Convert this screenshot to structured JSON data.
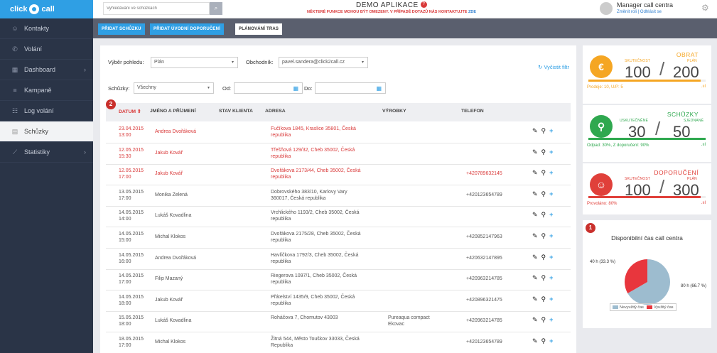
{
  "app": {
    "logo_text": "click",
    "logo_text2": "call"
  },
  "topbar": {
    "search_placeholder": "Vyhledávání ve schůzkách",
    "demo_title": "DEMO APLIKACE",
    "demo_badge": "?",
    "demo_subtitle": "NĚKTERÉ FUNKCE MOHOU BÝT OMEZENY. V PŘÍPADĚ DOTAZŮ NÁS KONTAKTUJTE",
    "demo_link": "ZDE",
    "user_name": "Manager call centra",
    "user_change_role": "Změnit roli",
    "user_separator": "|",
    "user_logout": "Odhlásit se"
  },
  "sidebar": {
    "items": [
      {
        "label": "Kontakty",
        "icon": "contacts-icon",
        "glyph": "☺",
        "chev": ""
      },
      {
        "label": "Volání",
        "icon": "phone-icon",
        "glyph": "✆",
        "chev": ""
      },
      {
        "label": "Dashboard",
        "icon": "dashboard-icon",
        "glyph": "▦",
        "chev": "›"
      },
      {
        "label": "Kampaně",
        "icon": "list-icon",
        "glyph": "≡",
        "chev": ""
      },
      {
        "label": "Log volání",
        "icon": "log-icon",
        "glyph": "☷",
        "chev": ""
      },
      {
        "label": "Schůzky",
        "icon": "calendar-icon",
        "glyph": "▤",
        "chev": ""
      },
      {
        "label": "Statistiky",
        "icon": "chart-icon",
        "glyph": "⟋",
        "chev": "›"
      }
    ]
  },
  "actions": {
    "add_meeting": "PŘIDAT SCHŮZKU",
    "add_referral": "PŘIDAT ÚVODNÍ DOPORUČENÍ",
    "plan_routes": "PLÁNOVÁNÍ TRAS"
  },
  "filters": {
    "view_label": "Výběr pohledu:",
    "view_value": "Plán",
    "dealer_label": "Obchodník:",
    "dealer_value": "pavel.sandera@click2call.cz",
    "meetings_label": "Schůzky:",
    "meetings_value": "Všechny",
    "from_label": "Od:",
    "to_label": "Do:",
    "clear": "Vyčistit filtr"
  },
  "table": {
    "badge": "2",
    "headers": [
      "DATUM ⇕",
      "JMÉNO A PŘÍJMENÍ",
      "STAV KLIENTA",
      "ADRESA",
      "VÝROBKY",
      "TELEFON"
    ],
    "rows": [
      {
        "date": "23.04.2015",
        "time": "13:00",
        "name": "Andrea Dvořáková",
        "addr1": "Fučíkova 1845, Kraslice 35801, Česká",
        "addr2": "republika",
        "product1": "",
        "product2": "",
        "phone": "",
        "red": true
      },
      {
        "date": "12.05.2015",
        "time": "15:30",
        "name": "Jakub Kovář",
        "addr1": "Třešňová 129/32, Cheb 35002, Česká",
        "addr2": "republika",
        "product1": "",
        "product2": "",
        "phone": "",
        "red": true
      },
      {
        "date": "12.05.2015",
        "time": "17:00",
        "name": "Jakub Kovář",
        "addr1": "Dvořákova 2173/44, Cheb 35002, Česká",
        "addr2": "republika",
        "product1": "",
        "product2": "",
        "phone": "+420789632145",
        "red": true
      },
      {
        "date": "13.05.2015",
        "time": "17:00",
        "name": "Monika Zelená",
        "addr1": "Dobrovského 383/10, Karlovy Vary",
        "addr2": "360017, Česká republika",
        "product1": "",
        "product2": "",
        "phone": "+420123654789",
        "red": false
      },
      {
        "date": "14.05.2015",
        "time": "14:00",
        "name": "Lukáš Kovadlina",
        "addr1": "Vrchlického 1193/2, Cheb 35002, Česká",
        "addr2": "republika",
        "product1": "",
        "product2": "",
        "phone": "",
        "red": false
      },
      {
        "date": "14.05.2015",
        "time": "15:00",
        "name": "Michal Klokos",
        "addr1": "Dvořákova 2175/28, Cheb 35002, Česká",
        "addr2": "republika",
        "product1": "",
        "product2": "",
        "phone": "+420852147963",
        "red": false
      },
      {
        "date": "14.05.2015",
        "time": "16:00",
        "name": "Andrea Dvořáková",
        "addr1": "Havlíčkova 1792/3, Cheb 35002, Česká",
        "addr2": "republika",
        "product1": "",
        "product2": "",
        "phone": "+420632147895",
        "red": false
      },
      {
        "date": "14.05.2015",
        "time": "17:00",
        "name": "Filip Mazaný",
        "addr1": "Riegerova 1097/1, Cheb 35002, Česká",
        "addr2": "republika",
        "product1": "",
        "product2": "",
        "phone": "+420963214785",
        "red": false
      },
      {
        "date": "14.05.2015",
        "time": "18:00",
        "name": "Jakub Kovář",
        "addr1": "Přátelství 1435/9, Cheb 35002, Česká",
        "addr2": "republika",
        "product1": "",
        "product2": "",
        "phone": "+420896321475",
        "red": false
      },
      {
        "date": "15.05.2015",
        "time": "18:00",
        "name": "Lukáš Kovadlina",
        "addr1": "Roháčova 7, Chomutov 43003",
        "addr2": "",
        "product1": "Pureaqua compact",
        "product2": "Ekovac",
        "phone": "+420963214785",
        "red": false
      },
      {
        "date": "18.05.2015",
        "time": "17:00",
        "name": "Michal Klokos",
        "addr1": "Žitná 544, Město Touškov 33033, Česká",
        "addr2": "Republika",
        "product1": "",
        "product2": "",
        "phone": "+420123654789",
        "red": false
      }
    ]
  },
  "cards": {
    "revenue": {
      "title": "OBRAT",
      "actual_label": "SKUTEČNOST",
      "plan_label": "PLÁN",
      "actual": "100",
      "plan": "200",
      "footer": "Prodeje: 10, U/P: 5",
      "color": "#f5a623",
      "progress": 0.96,
      "icon": "euro-icon",
      "glyph": "€",
      "bars": ".ııl"
    },
    "meetings": {
      "title": "SCHŮZKY",
      "actual_label": "USKUTEČNĚNÉ",
      "plan_label": "SJEDNANÉ",
      "actual": "30",
      "plan": "50",
      "footer": "Odpad: 30%, Z doporučení: 90%",
      "color": "#2fa84f",
      "progress": 1.0,
      "icon": "pin-icon",
      "glyph": "⚲",
      "bars": ".ııl"
    },
    "referrals": {
      "title": "DOPORUČENÍ",
      "actual_label": "SKUTEČNOST",
      "plan_label": "PLÁN",
      "actual": "100",
      "plan": "300",
      "footer": "Provoláno: 80%",
      "color": "#e0403a",
      "progress": 0.96,
      "icon": "smile-icon",
      "glyph": "☺",
      "bars": ".ııl"
    },
    "availability": {
      "badge": "1",
      "title": "Disponibilní čas call centra",
      "slice_used_label": "40 h (33.3 %)",
      "slice_free_label": "80 h (66.7 %)",
      "legend_free": "Nevyužitý čas",
      "legend_used": "Využitý čas",
      "free_color": "#9dbccf",
      "used_color": "#e8363d"
    }
  },
  "chart_data": {
    "type": "pie",
    "title": "Disponibilní čas call centra",
    "categories": [
      "Nevyužitý čas",
      "Využitý čas"
    ],
    "values": [
      80,
      40
    ],
    "labels": [
      "80 h (66.7 %)",
      "40 h (33.3 %)"
    ],
    "legend": "bottom"
  }
}
